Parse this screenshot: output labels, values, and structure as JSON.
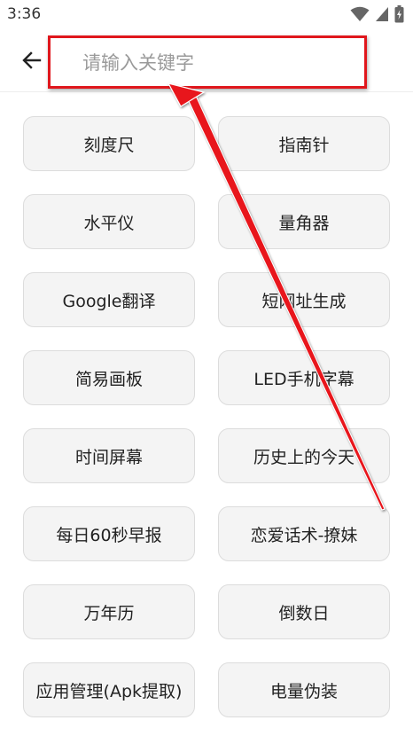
{
  "status_bar": {
    "time": "3:36",
    "icons": [
      "wifi-icon",
      "signal-icon",
      "battery-icon"
    ]
  },
  "header": {
    "back_icon": "arrow-left-icon",
    "search_placeholder": "请输入关键字",
    "search_value": ""
  },
  "tools": [
    {
      "label": "刻度尺"
    },
    {
      "label": "指南针"
    },
    {
      "label": "水平仪"
    },
    {
      "label": "量角器"
    },
    {
      "label": "Google翻译"
    },
    {
      "label": "短网址生成"
    },
    {
      "label": "简易画板"
    },
    {
      "label": "LED手机字幕"
    },
    {
      "label": "时间屏幕"
    },
    {
      "label": "历史上的今天"
    },
    {
      "label": "每日60秒早报"
    },
    {
      "label": "恋爱话术-撩妹"
    },
    {
      "label": "万年历"
    },
    {
      "label": "倒数日"
    },
    {
      "label": "应用管理(Apk提取)"
    },
    {
      "label": "电量伪装"
    }
  ],
  "colors": {
    "highlight": "#e0161c",
    "button_bg": "#f4f4f4",
    "button_border": "#dcdcdc"
  }
}
